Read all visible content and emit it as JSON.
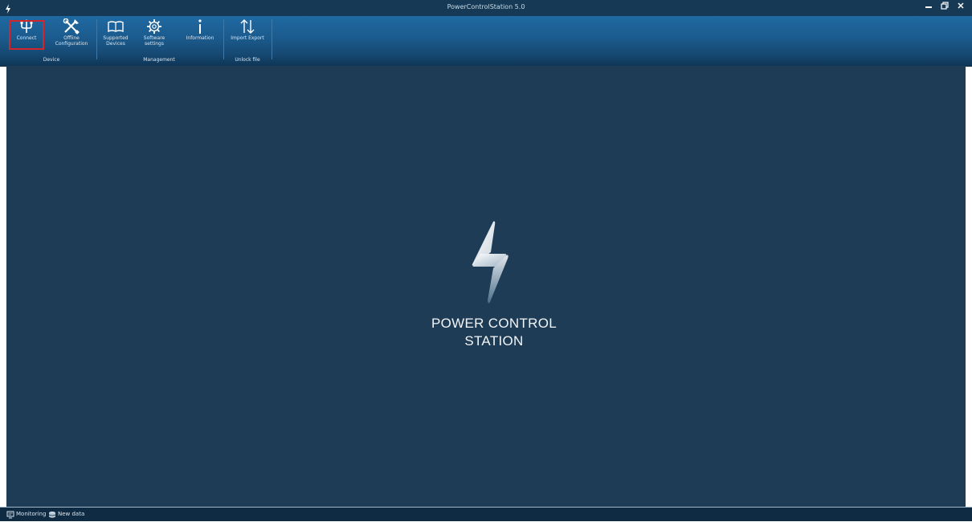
{
  "window": {
    "title": "PowerControlStation 5.0",
    "minimize_icon": "minimize-icon",
    "restore_icon": "restore-icon",
    "close_icon": "close-icon"
  },
  "ribbon": {
    "buttons": {
      "connect": {
        "label": "Connect",
        "icon": "usb-icon",
        "highlighted": true
      },
      "offline_configuration": {
        "label": "Offline\nConfiguration",
        "icon": "tools-icon"
      },
      "supported_devices": {
        "label": "Supported\nDevices",
        "icon": "book-icon"
      },
      "software_settings": {
        "label": "Software\nsettings",
        "icon": "gear-icon"
      },
      "information": {
        "label": "Information",
        "icon": "info-icon"
      },
      "import_export": {
        "label": "Import Export",
        "icon": "import-export-icon"
      }
    },
    "groups": {
      "device": "Device",
      "management": "Management",
      "unlock_file": "Unlock file"
    }
  },
  "main": {
    "brand_line1": "POWER CONTROL",
    "brand_line2": "STATION",
    "logo_icon": "lightning-bolt-icon"
  },
  "statusbar": {
    "monitoring": "Monitoring",
    "new_data": "New data"
  },
  "colors": {
    "background": "#1e3c56",
    "ribbon": "#1b5a8c",
    "highlight": "#d1272c"
  }
}
